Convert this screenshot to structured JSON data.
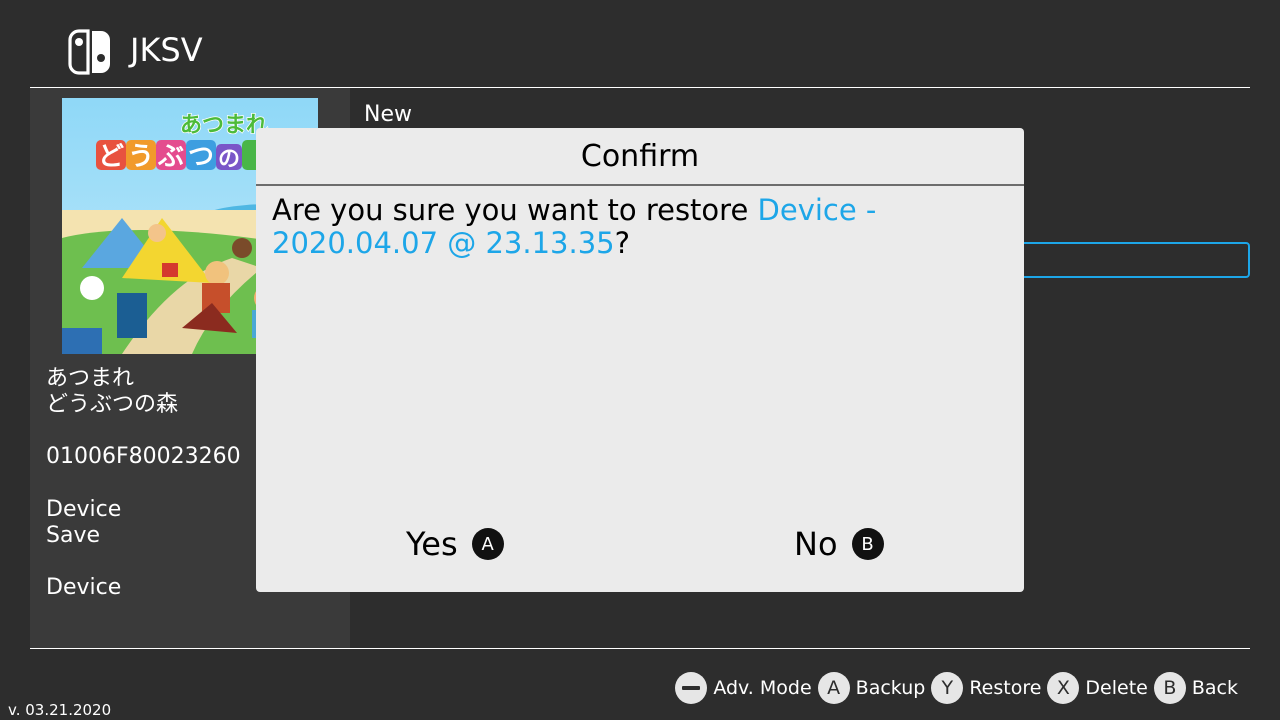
{
  "app": {
    "title": "JKSV",
    "version": "v. 03.21.2020"
  },
  "title_info": {
    "name_line1": "あつまれ",
    "name_line2": "どうぶつの森",
    "title_id": "01006F80023260",
    "save_type_line1": "Device",
    "save_type_line2": "Save",
    "user": "Device"
  },
  "save_list": {
    "items": [
      {
        "label": "New"
      }
    ]
  },
  "dialog": {
    "title": "Confirm",
    "message_prefix": "Are you sure you want to restore ",
    "message_highlight": "Device - 2020.04.07 @ 23.13.35",
    "message_suffix": "?",
    "yes_label": "Yes",
    "yes_glyph": "A",
    "no_label": "No",
    "no_glyph": "B"
  },
  "footer": {
    "hints": [
      {
        "glyph": "minus",
        "label": "Adv. Mode"
      },
      {
        "glyph": "A",
        "label": "Backup"
      },
      {
        "glyph": "Y",
        "label": "Restore"
      },
      {
        "glyph": "X",
        "label": "Delete"
      },
      {
        "glyph": "B",
        "label": "Back"
      }
    ]
  },
  "colors": {
    "background": "#2d2d2d",
    "panel": "#3a3a3a",
    "dialog": "#ebebeb",
    "accent": "#1da6e8"
  }
}
